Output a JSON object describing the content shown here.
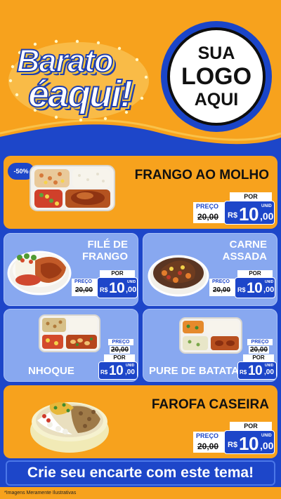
{
  "header": {
    "brand_line1": "Barato",
    "brand_line2": "éaqui!",
    "logo_line1": "SUA",
    "logo_line2": "LOGO",
    "logo_line3": "AQUI"
  },
  "colors": {
    "orange": "#f7a21d",
    "blue": "#1d46c9",
    "light_blue": "#88a8f0"
  },
  "price_labels": {
    "preco": "PREÇO",
    "por": "POR",
    "currency": "R$",
    "unit": "UNID"
  },
  "products": [
    {
      "name": "FRANGO AO MOLHO",
      "discount": "-50%",
      "old_price": "20,00",
      "price_int": "10",
      "price_cents": ",00"
    },
    {
      "name_line1": "FILÉ DE",
      "name_line2": "FRANGO",
      "old_price": "20,00",
      "price_int": "10",
      "price_cents": ",00"
    },
    {
      "name_line1": "CARNE",
      "name_line2": "ASSADA",
      "old_price": "20,00",
      "price_int": "10",
      "price_cents": ",00"
    },
    {
      "name": "NHOQUE",
      "old_price": "20,00",
      "price_int": "10",
      "price_cents": ",00"
    },
    {
      "name": "PURE DE BATATA",
      "old_price": "20,00",
      "price_int": "10",
      "price_cents": ",00"
    },
    {
      "name": "FAROFA CASEIRA",
      "old_price": "20,00",
      "price_int": "10",
      "price_cents": ",00"
    }
  ],
  "cta": "Crie seu encarte com este tema!",
  "footer": "*Imagens Meramente Ilustrativas"
}
